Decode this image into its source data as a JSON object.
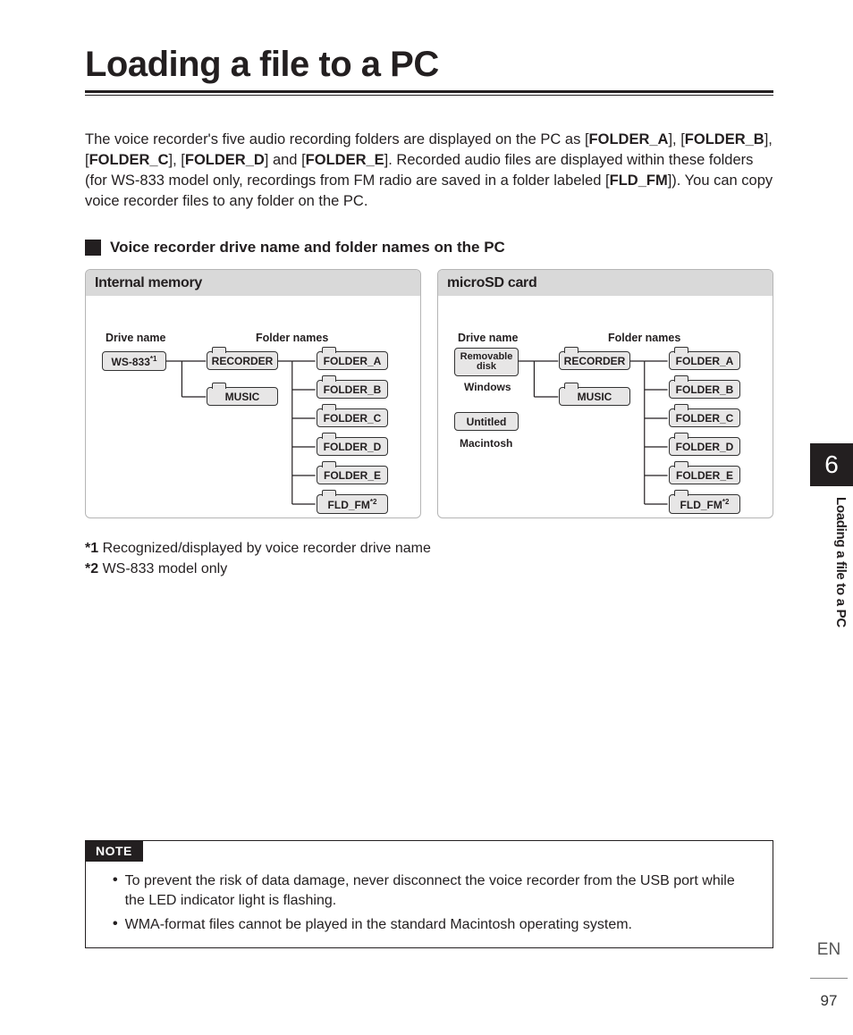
{
  "page": {
    "title": "Loading a file to a PC",
    "intro_html": "The voice recorder's five audio recording folders are displayed on the PC as [<b>FOLDER_A</b>], [<b>FOLDER_B</b>], [<b>FOLDER_C</b>], [<b>FOLDER_D</b>] and [<b>FOLDER_E</b>]. Recorded audio files are displayed within these folders (for WS-833 model only, recordings from FM radio are saved in a folder labeled [<b>FLD_FM</b>]). You can copy voice recorder files to any folder on the PC.",
    "section_heading": "Voice recorder drive name and folder names on the PC",
    "panels": {
      "internal": {
        "title": "Internal memory",
        "col_labels": {
          "drive": "Drive name",
          "folders": "Folder names"
        },
        "drive_label_html": "WS-833<sup>*1</sup>",
        "mid": {
          "recorder": "RECORDER",
          "music": "MUSIC"
        },
        "folders": [
          "FOLDER_A",
          "FOLDER_B",
          "FOLDER_C",
          "FOLDER_D",
          "FOLDER_E"
        ],
        "extra_html": "FLD_FM<sup>*2</sup>"
      },
      "microsd": {
        "title": "microSD card",
        "col_labels": {
          "drive": "Drive name",
          "folders": "Folder names"
        },
        "drives": [
          {
            "label": "Removable disk",
            "sub": "Windows"
          },
          {
            "label": "Untitled",
            "sub": "Macintosh"
          }
        ],
        "mid": {
          "recorder": "RECORDER",
          "music": "MUSIC"
        },
        "folders": [
          "FOLDER_A",
          "FOLDER_B",
          "FOLDER_C",
          "FOLDER_D",
          "FOLDER_E"
        ],
        "extra_html": "FLD_FM<sup>*2</sup>"
      }
    },
    "footnotes": [
      {
        "mark": "*1",
        "text": "Recognized/displayed by voice recorder drive name"
      },
      {
        "mark": "*2",
        "text": "WS-833 model only"
      }
    ],
    "note": {
      "badge": "NOTE",
      "items": [
        "To prevent the risk of data damage, never disconnect the voice recorder from the USB port while the LED indicator light is flashing.",
        "WMA-format files cannot be played in the standard Macintosh operating system."
      ]
    },
    "side": {
      "chapter": "6",
      "label": "Loading a file to a PC"
    },
    "lang": "EN",
    "number": "97"
  }
}
